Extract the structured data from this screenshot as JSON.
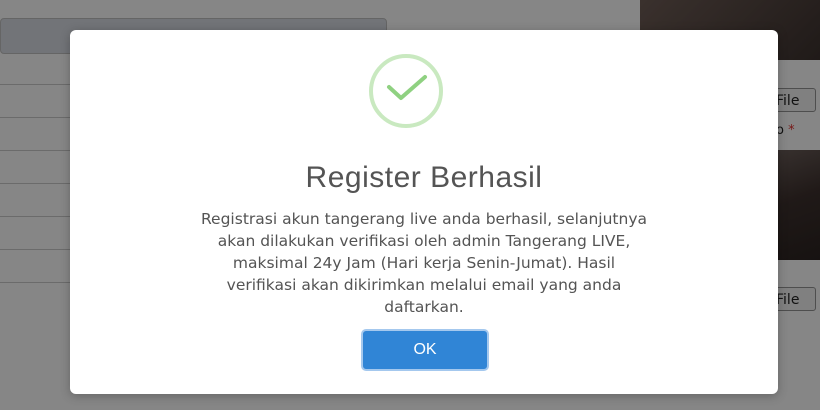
{
  "background": {
    "file_button_label": "File",
    "required_label_fragment": "o",
    "required_marker": "*"
  },
  "modal": {
    "icon": "check-icon",
    "icon_color": "#8fd181",
    "title": "Register Berhasil",
    "message_lines": [
      "Registrasi akun tangerang live anda berhasil, selanjutnya",
      "akan dilakukan verifikasi oleh admin Tangerang LIVE,",
      "maksimal 24y Jam (Hari kerja Senin-Jumat). Hasil",
      "verifikasi akan dikirimkan melalui email yang anda",
      "daftarkan."
    ],
    "ok_label": "OK",
    "ok_color": "#3085d6"
  }
}
